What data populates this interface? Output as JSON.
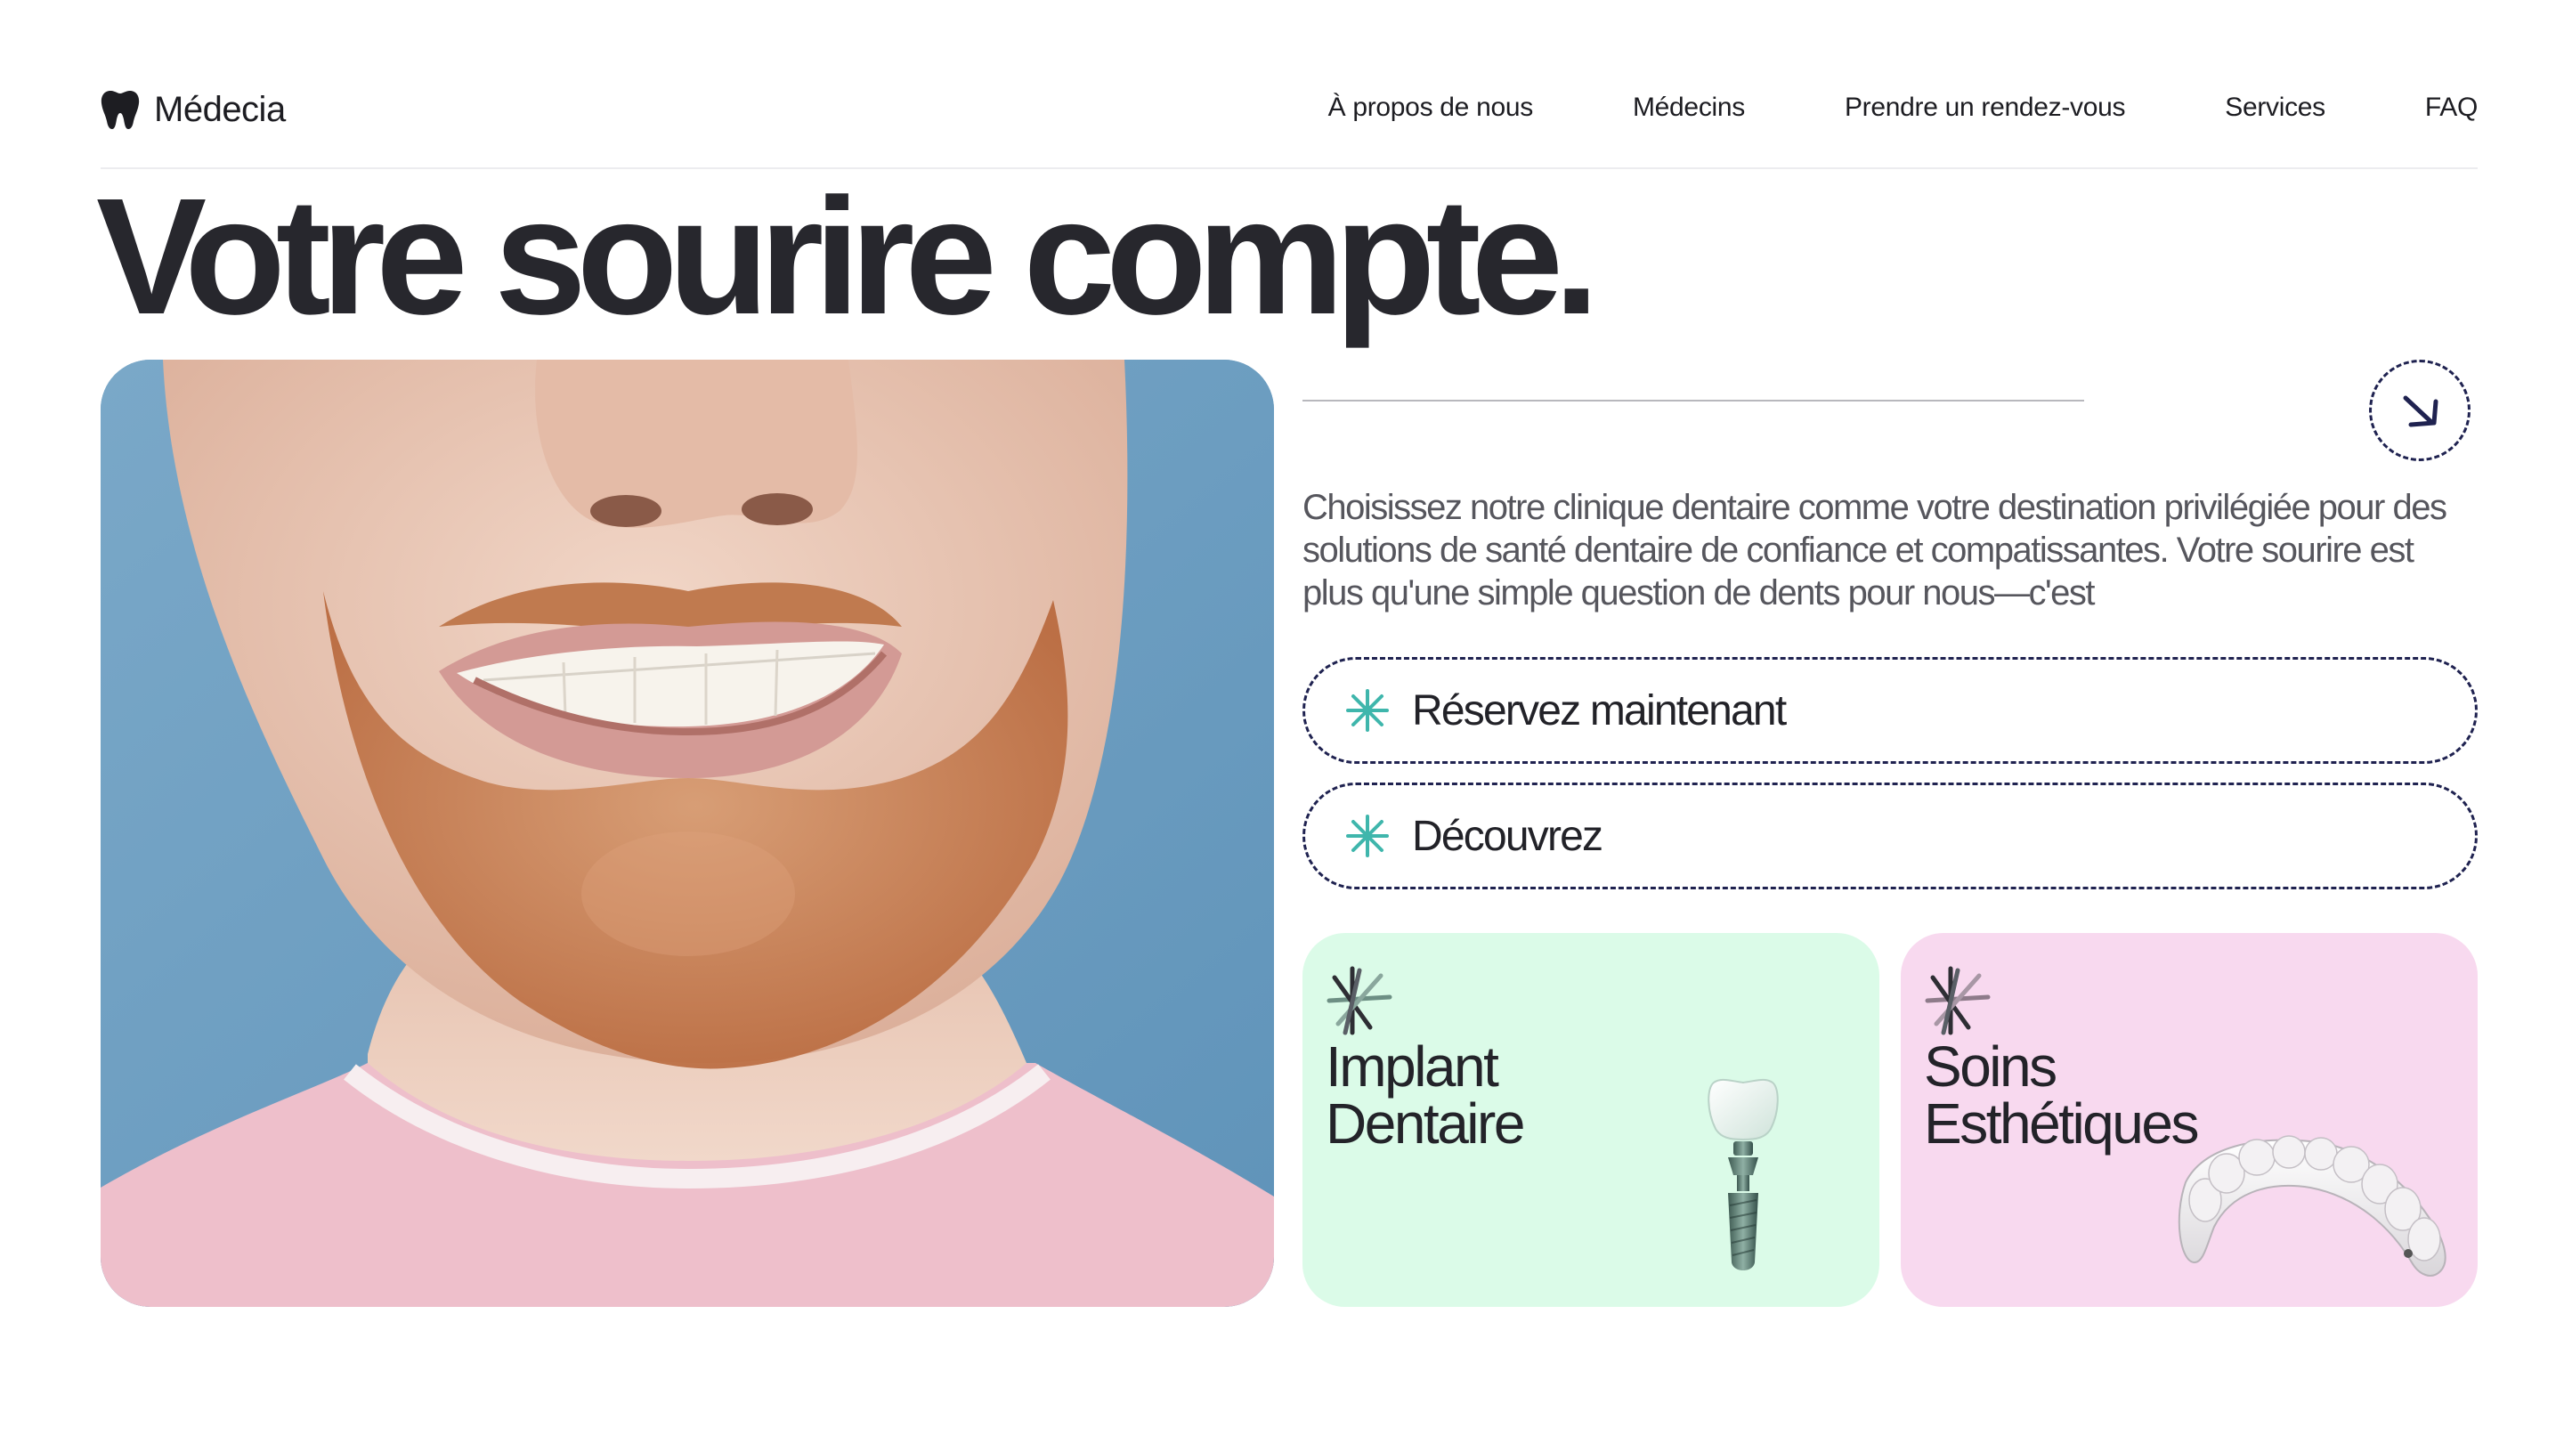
{
  "brand": {
    "name": "Médecia",
    "icon": "tooth-icon"
  },
  "nav": {
    "items": [
      "À propos de nous",
      "Médecins",
      "Prendre un rendez-vous",
      "Services",
      "FAQ"
    ]
  },
  "hero": {
    "title": "Votre sourire compte.",
    "description": "Choisissez notre clinique dentaire comme votre destination privilégiée pour des solutions de santé dentaire de confiance et compatissantes. Votre sourire est plus qu'une simple question de dents pour nous—c'est",
    "arrow_icon": "arrow-down-right-icon"
  },
  "actions": {
    "book_label": "Réservez maintenant",
    "discover_label": "Découvrez",
    "icon": "asterisk-icon"
  },
  "services": [
    {
      "title": "Implant\nDentaire",
      "icon": "sparkle-icon",
      "art": "dental-implant-illustration"
    },
    {
      "title": "Soins\nEsthétiques",
      "icon": "sparkle-icon",
      "art": "clear-aligner-illustration"
    }
  ],
  "colors": {
    "text_dark": "#27272d",
    "accent_teal": "#3fb6ac",
    "dashed_border": "#1f2250",
    "card_green": "#dbfbe8",
    "card_pink": "#f8d9ef",
    "photo_background": "#6f9fc0"
  }
}
